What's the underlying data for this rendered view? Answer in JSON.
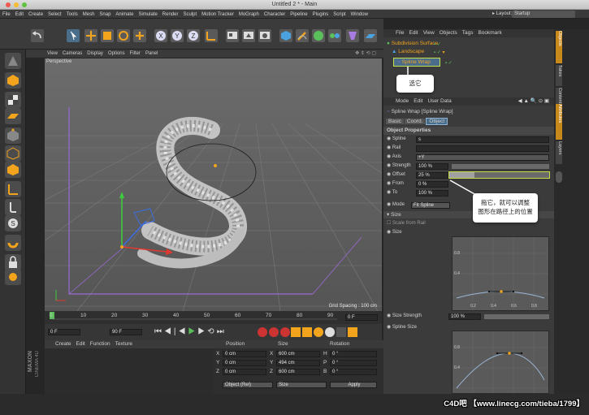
{
  "window": {
    "title": "Untitled 2 * - Main"
  },
  "menu": [
    "File",
    "Edit",
    "Create",
    "Select",
    "Tools",
    "Mesh",
    "Snap",
    "Animate",
    "Simulate",
    "Render",
    "Sculpt",
    "Motion Tracker",
    "MoGraph",
    "Character",
    "Pipeline",
    "Plugins",
    "Script",
    "Window"
  ],
  "layout": {
    "label": "▸ Layout:",
    "value": "Startup"
  },
  "viewport": {
    "menu": [
      "View",
      "Cameras",
      "Display",
      "Options",
      "Filter",
      "Panel"
    ],
    "camera_label": "Perspective",
    "grid_spacing": "Grid Spacing : 100 cm"
  },
  "timeline": {
    "ticks": [
      "0",
      "10",
      "20",
      "30",
      "40",
      "50",
      "60",
      "70",
      "80",
      "90"
    ],
    "frame_field": "0 F"
  },
  "playback": {
    "start": "0 F",
    "end": "90 F"
  },
  "materials": {
    "menu": [
      "Create",
      "Edit",
      "Function",
      "Texture"
    ]
  },
  "coords": {
    "headers": [
      "Position",
      "Size",
      "Rotation"
    ],
    "rows": [
      {
        "axis": "X",
        "pos": "0 cm",
        "size_axis": "X",
        "size": "600 cm",
        "rot_axis": "H",
        "rot": "0 °"
      },
      {
        "axis": "Y",
        "pos": "0 cm",
        "size_axis": "Y",
        "size": "494 cm",
        "rot_axis": "P",
        "rot": "0 °"
      },
      {
        "axis": "Z",
        "pos": "0 cm",
        "size_axis": "Z",
        "size": "600 cm",
        "rot_axis": "B",
        "rot": "0 °"
      }
    ],
    "mode": "Object (Rel)",
    "size_mode": "Size",
    "apply": "Apply"
  },
  "objects": {
    "menu": [
      "File",
      "Edit",
      "View",
      "Objects",
      "Tags",
      "Bookmark"
    ],
    "items": [
      "Subdivision Surface",
      "Landscape",
      "Spline Wrap"
    ],
    "callout": "选它"
  },
  "attributes": {
    "menu": [
      "Mode",
      "Edit",
      "User Data"
    ],
    "title": "Spline Wrap [Spline Wrap]",
    "tabs": [
      "Basic",
      "Coord.",
      "Object"
    ],
    "section": "Object Properties",
    "fields": [
      {
        "label": "Spline",
        "value": "s"
      },
      {
        "label": "Rail",
        "value": ""
      },
      {
        "label": "Axis",
        "value": "+Y"
      },
      {
        "label": "Strength",
        "value": "100 %"
      },
      {
        "label": "Offset",
        "value": "25 %"
      },
      {
        "label": "From",
        "value": "0 %"
      },
      {
        "label": "To",
        "value": "100 %"
      }
    ],
    "mode_label": "Mode",
    "mode_value": "Fit Spline",
    "size_group": "▾ Size",
    "scale_from_rail": "Scale from Rail",
    "size_label": "Size",
    "size_strength_label": "Size Strength",
    "size_strength_value": "100 %",
    "spline_size_label": "Spline Size",
    "graph_y_labels": [
      "0.8",
      "0.4"
    ],
    "graph_x_labels": [
      "0.0",
      "0.2",
      "0.4",
      "0.6",
      "0.8"
    ],
    "callout": "拖它，就可以调整\n图形在路径上的位置"
  },
  "right_tabs": [
    "Objects",
    "Takes",
    "Content Browser",
    "Attributes",
    "Layers"
  ],
  "branding": {
    "logo_top": "MAXON",
    "logo_bottom": "CINEMA 4D"
  },
  "watermark": "C4D吧 【www.linecg.com/tieba/1799】",
  "colors": {
    "accent_orange": "#f2a41c",
    "selection": "#4a6d8a",
    "spline_wrap_highlight": "#c6e04a",
    "grid": "#6e6e6e"
  }
}
